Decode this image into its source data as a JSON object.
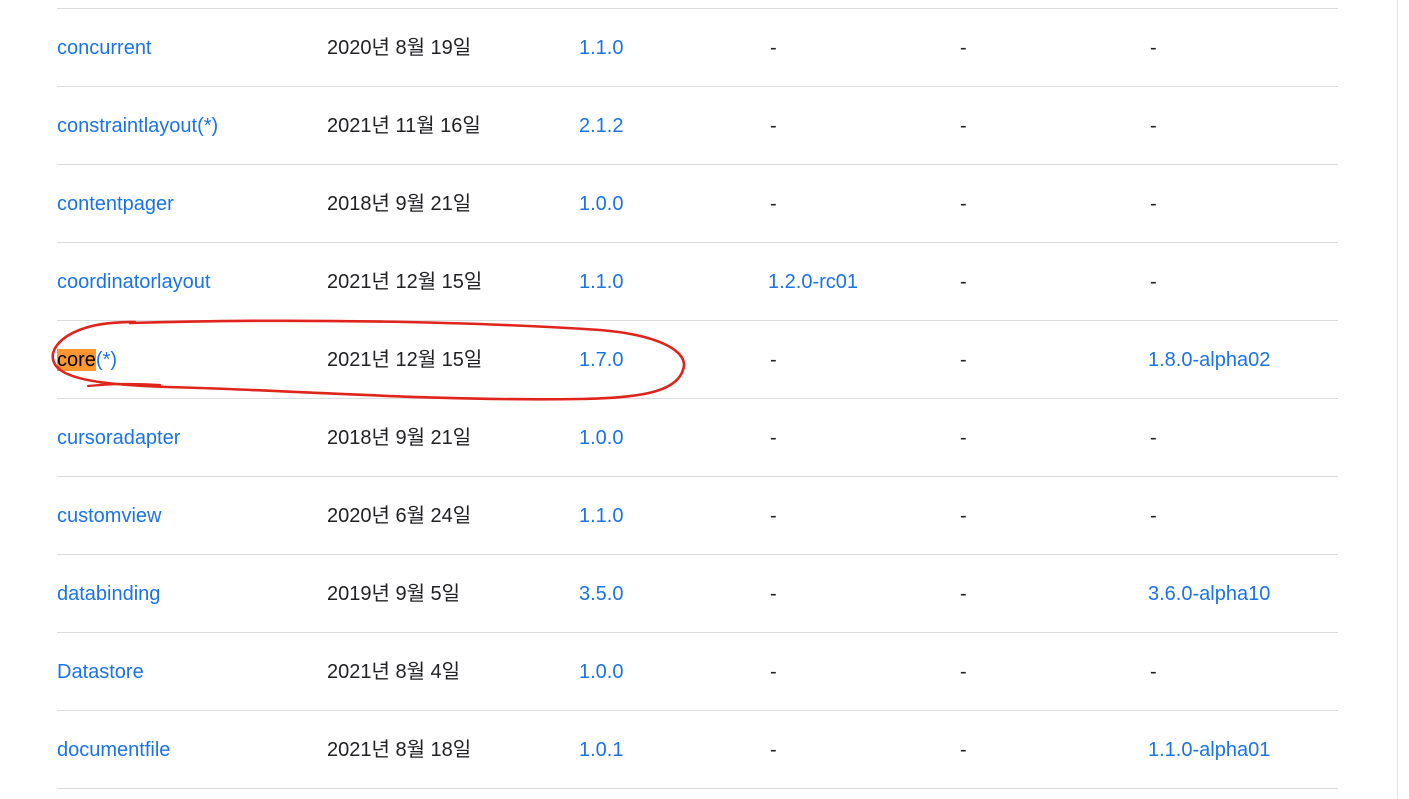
{
  "accent_link_color": "#1a73e8",
  "highlight_color": "#ff9632",
  "annotation_color": "#e0241b",
  "rows": [
    {
      "name": "concurrent",
      "name_hl": "",
      "name_rest": "",
      "date": "2020년 8월 19일",
      "stable": "1.1.0",
      "rc": "-",
      "beta": "-",
      "alpha": "-"
    },
    {
      "name": "constraintlayout(*)",
      "name_hl": "",
      "name_rest": "",
      "date": "2021년 11월 16일",
      "stable": "2.1.2",
      "rc": "-",
      "beta": "-",
      "alpha": "-"
    },
    {
      "name": "contentpager",
      "name_hl": "",
      "name_rest": "",
      "date": "2018년 9월 21일",
      "stable": "1.0.0",
      "rc": "-",
      "beta": "-",
      "alpha": "-"
    },
    {
      "name": "coordinatorlayout",
      "name_hl": "",
      "name_rest": "",
      "date": "2021년 12월 15일",
      "stable": "1.1.0",
      "rc": "1.2.0-rc01",
      "beta": "-",
      "alpha": "-"
    },
    {
      "name": "",
      "name_hl": "core",
      "name_rest": "(*)",
      "date": "2021년 12월 15일",
      "stable": "1.7.0",
      "rc": "-",
      "beta": "-",
      "alpha": "1.8.0-alpha02"
    },
    {
      "name": "cursoradapter",
      "name_hl": "",
      "name_rest": "",
      "date": "2018년 9월 21일",
      "stable": "1.0.0",
      "rc": "-",
      "beta": "-",
      "alpha": "-"
    },
    {
      "name": "customview",
      "name_hl": "",
      "name_rest": "",
      "date": "2020년 6월 24일",
      "stable": "1.1.0",
      "rc": "-",
      "beta": "-",
      "alpha": "-"
    },
    {
      "name": "databinding",
      "name_hl": "",
      "name_rest": "",
      "date": "2019년 9월 5일",
      "stable": "3.5.0",
      "rc": "-",
      "beta": "-",
      "alpha": "3.6.0-alpha10"
    },
    {
      "name": "Datastore",
      "name_hl": "",
      "name_rest": "",
      "date": "2021년 8월 4일",
      "stable": "1.0.0",
      "rc": "-",
      "beta": "-",
      "alpha": "-"
    },
    {
      "name": "documentfile",
      "name_hl": "",
      "name_rest": "",
      "date": "2021년 8월 18일",
      "stable": "1.0.1",
      "rc": "-",
      "beta": "-",
      "alpha": "1.1.0-alpha01"
    }
  ]
}
